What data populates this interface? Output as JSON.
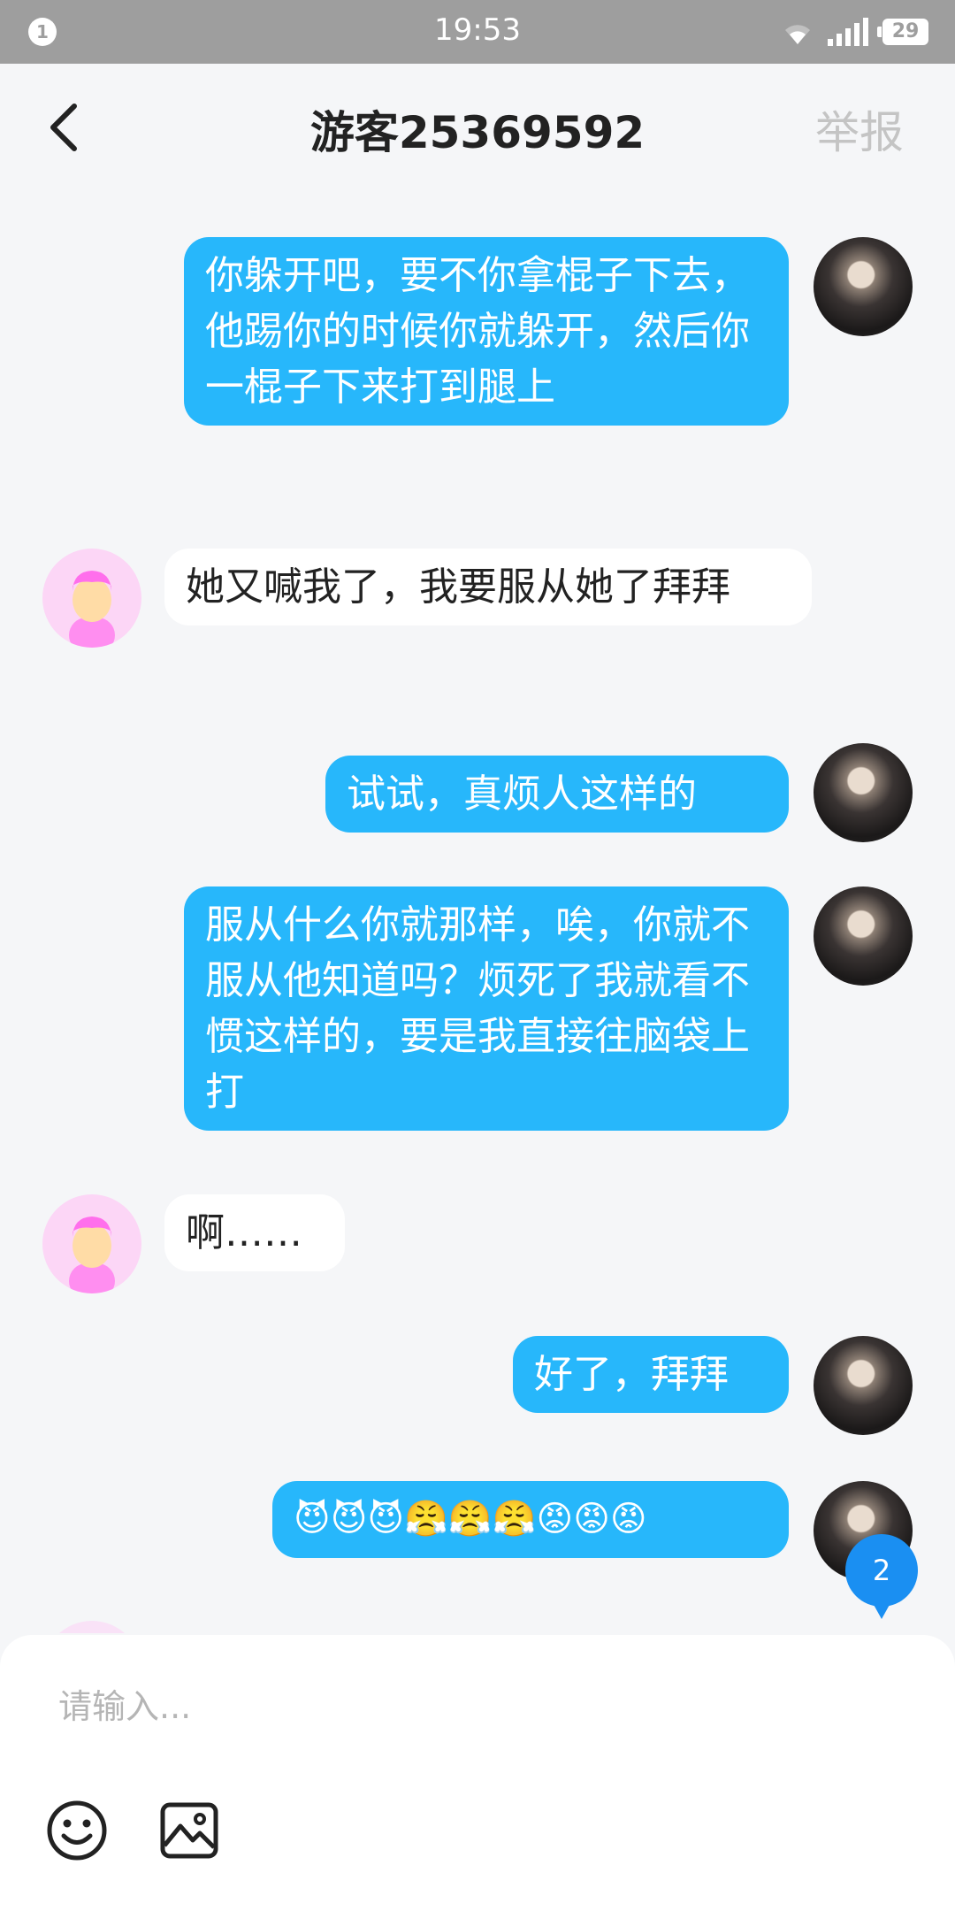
{
  "status_bar": {
    "notification_count": "1",
    "time": "19:53",
    "battery": "29"
  },
  "header": {
    "title": "游客25369592",
    "report_label": "举报"
  },
  "messages": [
    {
      "sender": "me",
      "text": "你躲开吧，要不你拿棍子下去，他踢你的时候你就躲开，然后你一棍子下来打到腿上"
    },
    {
      "sender": "other",
      "text": "她又喊我了，我要服从她了拜拜"
    },
    {
      "sender": "me",
      "text": "试试，真烦人这样的"
    },
    {
      "sender": "me",
      "text": "服从什么你就那样，唉，你就不服从他知道吗？烦死了我就看不惯这样的，要是我直接往脑袋上打"
    },
    {
      "sender": "other",
      "text": "啊……"
    },
    {
      "sender": "me",
      "text": "好了，拜拜"
    },
    {
      "sender": "me",
      "text": "😈😈😈😤😤😤😡😡😡"
    }
  ],
  "unread_count": "2",
  "input": {
    "placeholder": "请输入..."
  },
  "icons": {
    "back": "chevron-left-icon",
    "emoji": "smiley-icon",
    "image": "image-icon"
  },
  "colors": {
    "my_bubble": "#27b7fb",
    "their_bubble": "#ffffff",
    "status_bar": "#9e9e9e",
    "badge": "#1a8ff2"
  }
}
